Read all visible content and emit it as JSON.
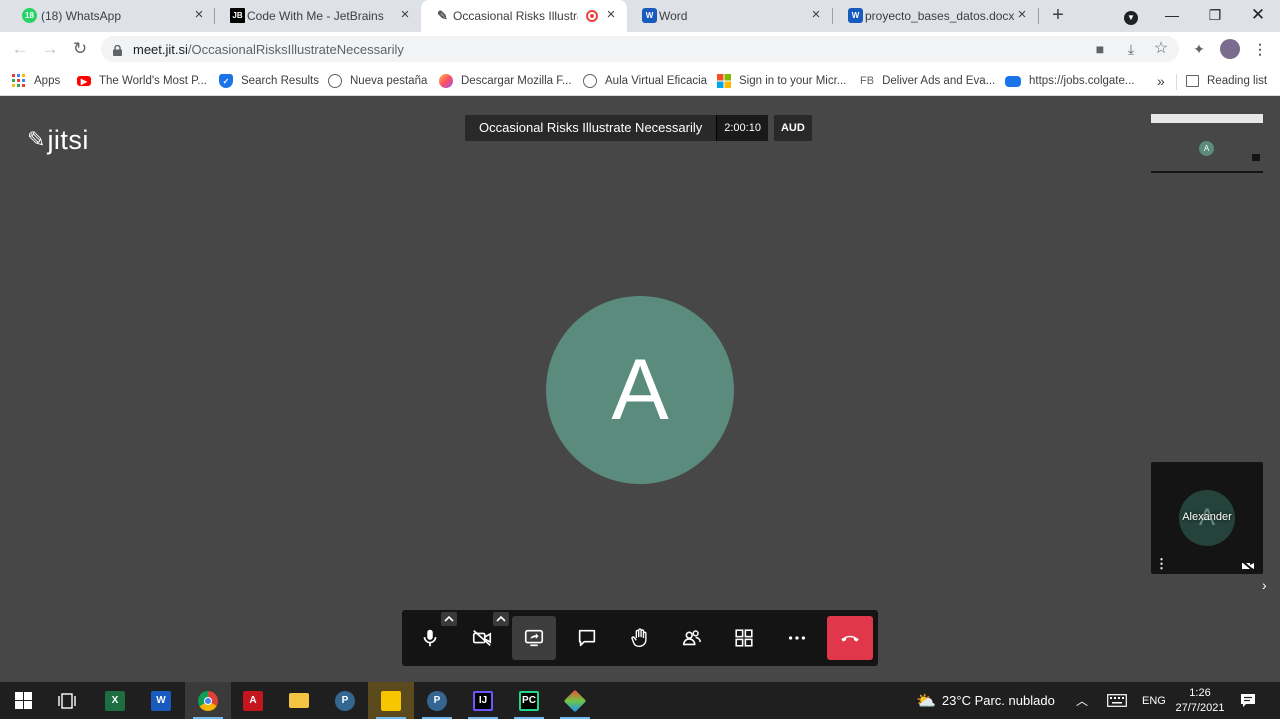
{
  "browser": {
    "tabs": [
      {
        "label": "(18) WhatsApp",
        "favicon": "whatsapp-icon",
        "badge": "18"
      },
      {
        "label": "Code With Me - JetBrains",
        "favicon": "jetbrains-icon",
        "badge": "JB"
      },
      {
        "label": "Occasional Risks Illustrate",
        "favicon": "jitsi-icon",
        "active": true
      },
      {
        "label": "Word",
        "favicon": "word-icon",
        "badge": "W"
      },
      {
        "label": "proyecto_bases_datos.docx",
        "favicon": "word-icon",
        "badge": "W"
      }
    ],
    "url": {
      "host": "meet.jit.si",
      "path": "/OccasionalRisksIllustrateNecessarily"
    },
    "bookmarks": [
      {
        "label": "Apps",
        "icon": "apps-grid-icon"
      },
      {
        "label": "The World's Most P...",
        "icon": "youtube-icon"
      },
      {
        "label": "Search Results",
        "icon": "shield-icon"
      },
      {
        "label": "Nueva pestaña",
        "icon": "globe-icon"
      },
      {
        "label": "Descargar Mozilla F...",
        "icon": "firefox-icon"
      },
      {
        "label": "Aula Virtual Eficacia",
        "icon": "globe-icon"
      },
      {
        "label": "Sign in to your Micr...",
        "icon": "microsoft-icon"
      },
      {
        "label": "Deliver Ads and Eva...",
        "icon": "fb-icon",
        "badge": "FB"
      },
      {
        "label": "https://jobs.colgate...",
        "icon": "colgate-icon"
      }
    ],
    "bookmarks_overflow": "»",
    "reading_list": "Reading list"
  },
  "meeting": {
    "logo": "jitsi",
    "subject": "Occasional Risks Illustrate Necessarily",
    "timer": "2:00:10",
    "audio_badge": "AUD",
    "avatar_letter": "A",
    "avatar_color": "#5a8b7c",
    "self_view": {
      "name": "Alexander",
      "avatar_letter": "A"
    }
  },
  "taskbar": {
    "weather": "23°C  Parc. nublado",
    "lang": "ENG",
    "time": "1:26",
    "date": "27/7/2021"
  }
}
